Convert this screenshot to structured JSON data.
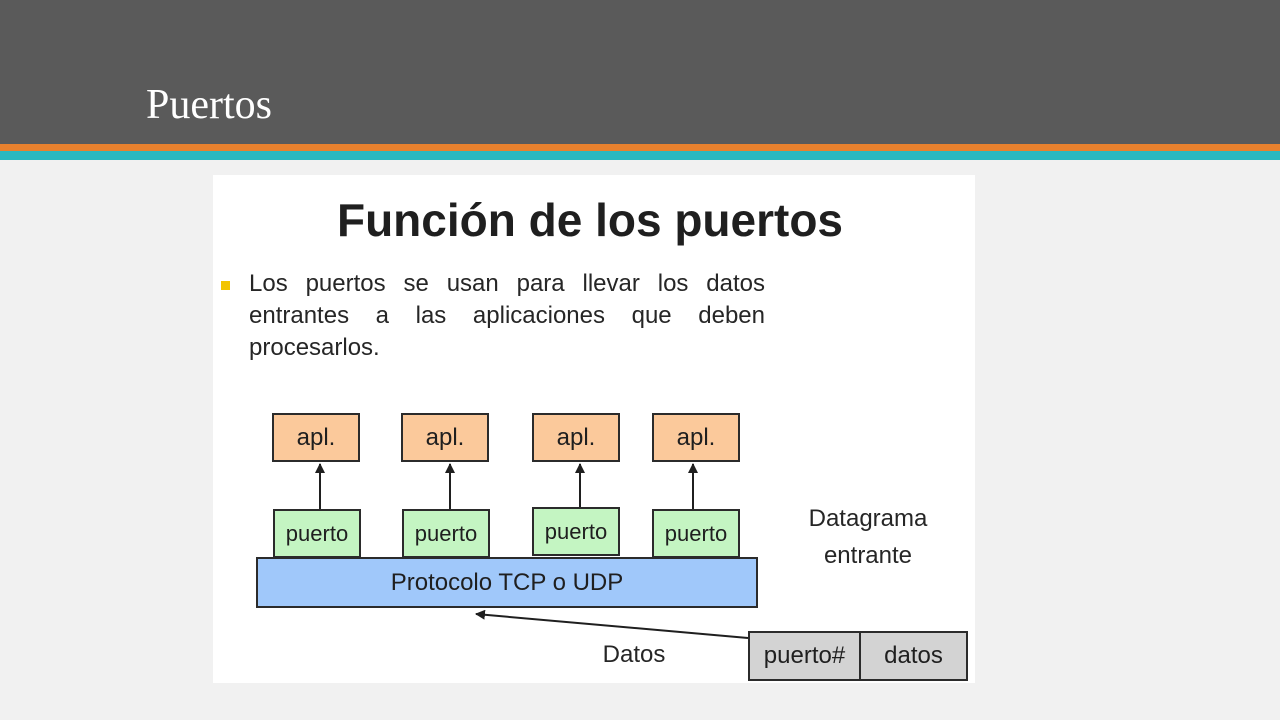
{
  "slide": {
    "title": "Puertos",
    "colors": {
      "header": "#5a5a5a",
      "stripe_orange": "#e8812e",
      "stripe_teal": "#2ab8bf"
    }
  },
  "figure": {
    "heading": "Función de los puertos",
    "bullet_text": "Los puertos se usan para llevar los datos entrantes a las aplicaciones que deben procesarlos.",
    "app_boxes": [
      "apl.",
      "apl.",
      "apl.",
      "apl."
    ],
    "port_boxes": [
      "puerto",
      "puerto",
      "puerto",
      "puerto"
    ],
    "protocol_label": "Protocolo TCP o UDP",
    "datagram_label_line1": "Datagrama",
    "datagram_label_line2": "entrante",
    "data_label": "Datos",
    "datagram_fields": [
      "puerto#",
      "datos"
    ],
    "colors": {
      "app": "#fbc99b",
      "port": "#c4f5c2",
      "protocol": "#a0c8fa",
      "field": "#d3d3d3",
      "bullet": "#f2c400"
    }
  }
}
